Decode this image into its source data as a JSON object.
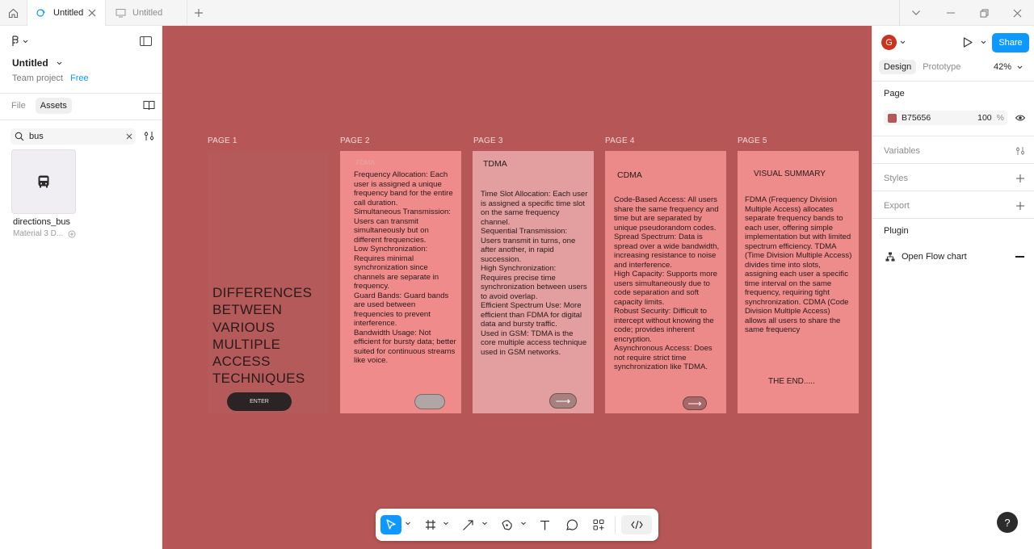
{
  "tabs": [
    {
      "label": "Untitled",
      "active": true
    },
    {
      "label": "Untitled",
      "active": false
    }
  ],
  "left": {
    "file_title": "Untitled",
    "team": "Team project",
    "plan": "Free",
    "tabs": [
      "File",
      "Assets"
    ],
    "search_value": "bus",
    "asset": {
      "name": "directions_bus",
      "library": "Material 3 D..."
    }
  },
  "canvas": {
    "background": "#b75656",
    "frames": [
      {
        "label": "PAGE 1",
        "title": "DIFFERENCES BETWEEN VARIOUS MULTIPLE ACCESS TECHNIQUES",
        "button": "ENTER"
      },
      {
        "label": "PAGE 2",
        "ghost": "FDMA",
        "body": "Frequency Allocation: Each user is assigned a unique frequency band for the entire call duration.\nSimultaneous Transmission: Users can transmit simultaneously but on different frequencies.\nLow Synchronization: Requires minimal synchronization since channels are separate in frequency.\nGuard Bands: Guard bands are used between frequencies to prevent interference.\nBandwidth Usage: Not efficient for bursty data; better suited for continuous streams like voice."
      },
      {
        "label": "PAGE 3",
        "heading": "TDMA",
        "body": "Time Slot Allocation: Each user is assigned a specific time slot on the same frequency channel.\nSequential Transmission: Users transmit in turns, one after another, in rapid succession.\nHigh Synchronization: Requires precise time synchronization between users to avoid overlap.\nEfficient Spectrum Use: More efficient than FDMA for digital data and bursty traffic.\nUsed in GSM: TDMA is the core multiple access technique used in GSM networks.",
        "arrow": "⟶"
      },
      {
        "label": "PAGE 4",
        "heading": "CDMA",
        "body": "Code-Based Access: All users share the same frequency and time but are separated by unique pseudorandom codes.\nSpread Spectrum: Data is spread over a wide bandwidth, increasing resistance to noise and interference.\nHigh Capacity: Supports more users simultaneously due to code separation and soft capacity limits.\nRobust Security: Difficult to intercept without knowing the code; provides inherent encryption.\nAsynchronous Access: Does not require strict time synchronization like TDMA.",
        "arrow": "⟶"
      },
      {
        "label": "PAGE 5",
        "heading": "VISUAL SUMMARY",
        "body": "FDMA (Frequency Division Multiple Access) allocates separate frequency bands to each user, offering simple implementation but with limited spectrum efficiency. TDMA (Time Division Multiple Access) divides time into slots, assigning each user a specific time interval on the same frequency, requiring tight synchronization. CDMA (Code Division Multiple Access) allows all users to share the same frequency",
        "end": "THE END....."
      }
    ]
  },
  "toolbar": {
    "tools": [
      "move-tool",
      "frame-tool",
      "shape-tool",
      "pen-tool",
      "text-tool",
      "comment-tool",
      "actions-tool",
      "dev-mode-toggle"
    ]
  },
  "right": {
    "avatar": "G",
    "share": "Share",
    "tabs": [
      "Design",
      "Prototype"
    ],
    "zoom": "42%",
    "page_section": "Page",
    "page_color_hex": "B75656",
    "page_opacity": "100",
    "pct": "%",
    "variables": "Variables",
    "styles": "Styles",
    "export": "Export",
    "plugin_section": "Plugin",
    "plugin_name": "Open Flow chart",
    "help": "?"
  }
}
